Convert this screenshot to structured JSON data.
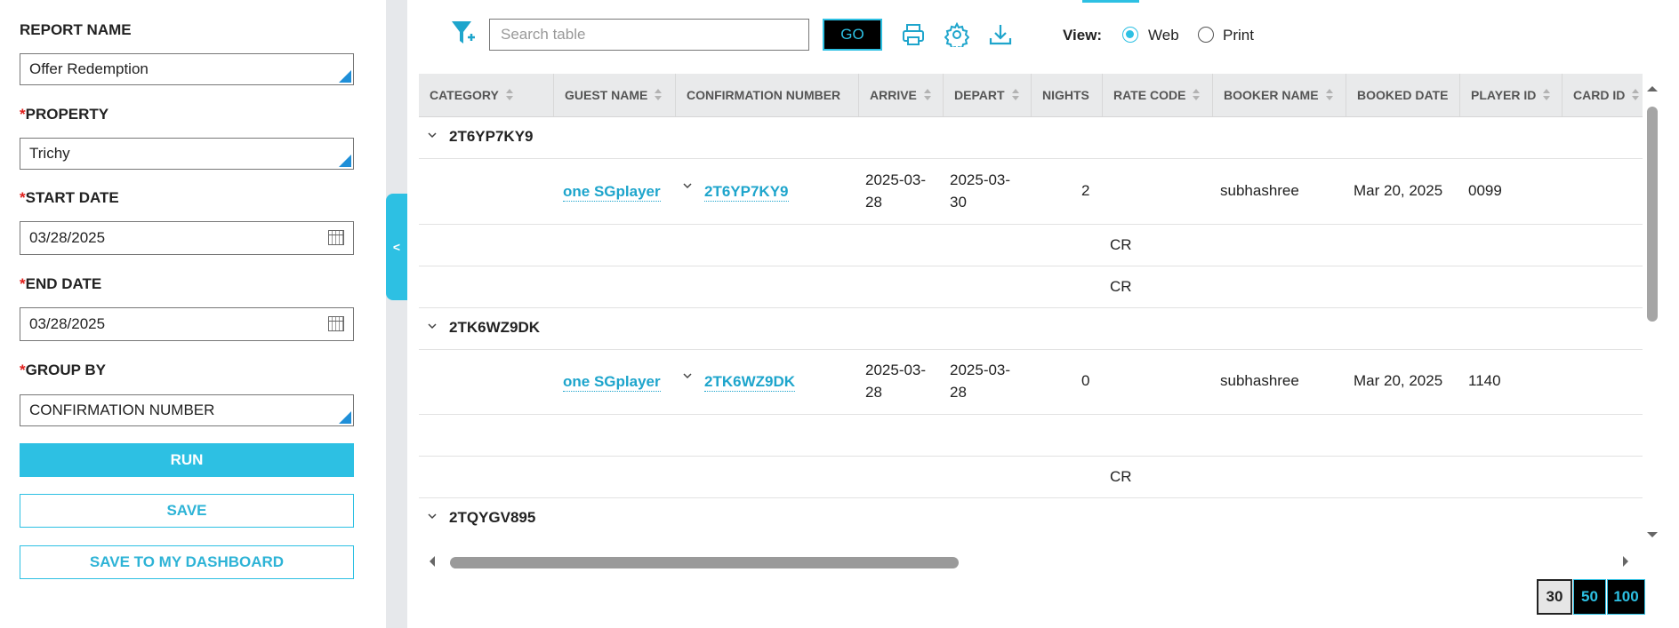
{
  "sidebar": {
    "report_name_label": "REPORT NAME",
    "report_name_value": "Offer Redemption",
    "property_label": "PROPERTY",
    "property_value": "Trichy",
    "start_date_label": "START DATE",
    "start_date_value": "03/28/2025",
    "end_date_label": "END DATE",
    "end_date_value": "03/28/2025",
    "group_by_label": "GROUP BY",
    "group_by_value": "CONFIRMATION NUMBER",
    "required_marker": "*",
    "run_label": "RUN",
    "save_label": "SAVE",
    "save_dashboard_label": "SAVE TO MY DASHBOARD",
    "collapse_glyph": "<"
  },
  "toolbar": {
    "search_placeholder": "Search table",
    "go_label": "GO",
    "view_label": "View:",
    "view_web": "Web",
    "view_print": "Print",
    "selected_view": "Web"
  },
  "table": {
    "columns": [
      "CATEGORY",
      "GUEST NAME",
      "CONFIRMATION NUMBER",
      "ARRIVE",
      "DEPART",
      "NIGHTS",
      "RATE CODE",
      "BOOKER NAME",
      "BOOKED DATE",
      "PLAYER ID",
      "CARD ID"
    ],
    "groups": [
      {
        "name": "2T6YP7KY9",
        "row": {
          "guest": "one SGplayer",
          "confirmation": "2T6YP7KY9",
          "arrive_1": "2025-03-",
          "arrive_2": "28",
          "depart_1": "2025-03-",
          "depart_2": "30",
          "nights": "2",
          "booker": "subhashree",
          "booked_date": "Mar 20, 2025",
          "player_id": "0099"
        },
        "sub_rows": [
          "CR",
          "CR"
        ]
      },
      {
        "name": "2TK6WZ9DK",
        "row": {
          "guest": "one SGplayer",
          "confirmation": "2TK6WZ9DK",
          "arrive_1": "2025-03-",
          "arrive_2": "28",
          "depart_1": "2025-03-",
          "depart_2": "28",
          "nights": "0",
          "booker": "subhashree",
          "booked_date": "Mar 20, 2025",
          "player_id": "1140"
        },
        "sub_rows": [
          "",
          "CR"
        ]
      },
      {
        "name": "2TQYGV895"
      }
    ]
  },
  "pagination": {
    "sizes": [
      "30",
      "50",
      "100"
    ],
    "active": "30"
  },
  "colors": {
    "accent": "#2dc0e3",
    "link": "#1ea5cc",
    "required": "#e0201c"
  }
}
